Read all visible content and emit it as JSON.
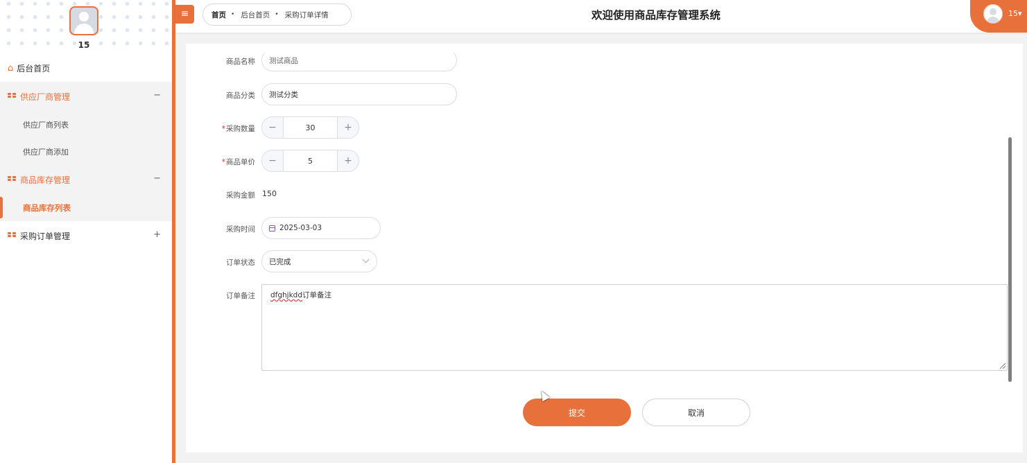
{
  "sidebar": {
    "profile_name": "15",
    "home_label": "后台首页",
    "groups": [
      {
        "label": "供应厂商管理",
        "toggle": "−",
        "items": [
          {
            "label": "供应厂商列表"
          },
          {
            "label": "供应厂商添加"
          }
        ]
      },
      {
        "label": "商品库存管理",
        "toggle": "−",
        "items": [
          {
            "label": "商品库存列表",
            "active": true
          }
        ]
      },
      {
        "label": "采购订单管理",
        "toggle": "+",
        "items": []
      }
    ]
  },
  "header": {
    "menu_icon": "≡",
    "breadcrumb": [
      "首页",
      "后台首页",
      "采购订单详情"
    ],
    "breadcrumb_sep": "•",
    "title": "欢迎使用商品库存管理系统",
    "user_name": "15"
  },
  "form": {
    "product_name": {
      "label": "商品名称",
      "value": "测试商品"
    },
    "category": {
      "label": "商品分类",
      "value": "测试分类"
    },
    "quantity": {
      "label": "采购数量",
      "value": "30",
      "minus": "−",
      "plus": "+"
    },
    "unit_price": {
      "label": "商品单价",
      "value": "5",
      "minus": "−",
      "plus": "+"
    },
    "amount": {
      "label": "采购金额",
      "value": "150"
    },
    "purchase_time": {
      "label": "采购时间",
      "value": "2025-03-03"
    },
    "status": {
      "label": "订单状态",
      "value": "已完成"
    },
    "remark": {
      "label": "订单备注",
      "value_prefix": "dfghjkdd",
      "value_suffix": "订单备注"
    },
    "required_mark": "*"
  },
  "actions": {
    "submit": "提交",
    "cancel": "取消"
  },
  "colors": {
    "accent": "#e8703a",
    "required": "#e5312b"
  }
}
